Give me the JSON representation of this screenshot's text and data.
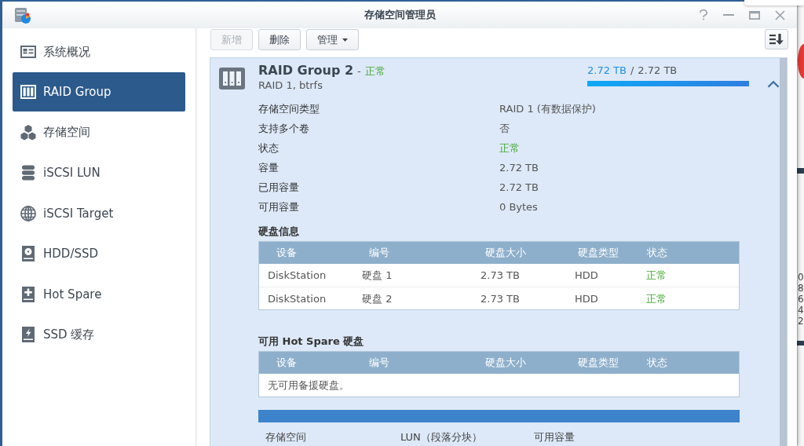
{
  "window": {
    "title": "存储空间管理员"
  },
  "sidebar": {
    "items": [
      {
        "label": "系统概况",
        "kind": "overview",
        "selected": false
      },
      {
        "label": "RAID Group",
        "kind": "raid",
        "selected": true
      },
      {
        "label": "存储空间",
        "kind": "storage",
        "selected": false
      },
      {
        "label": "iSCSI LUN",
        "kind": "lun",
        "selected": false
      },
      {
        "label": "iSCSI Target",
        "kind": "target",
        "selected": false
      },
      {
        "label": "HDD/SSD",
        "kind": "hdd",
        "selected": false
      },
      {
        "label": "Hot Spare",
        "kind": "hotspare",
        "selected": false
      },
      {
        "label": "SSD 缓存",
        "kind": "cache",
        "selected": false
      }
    ]
  },
  "toolbar": {
    "buttons": [
      {
        "label": "新增",
        "disabled": true,
        "dropdown": false
      },
      {
        "label": "删除",
        "disabled": false,
        "dropdown": false
      },
      {
        "label": "管理",
        "disabled": false,
        "dropdown": true
      }
    ]
  },
  "raid_group": {
    "name": "RAID Group 2",
    "separator": "-",
    "status": "正常",
    "healthy": true,
    "subtitle": "RAID 1, btrfs",
    "usage": {
      "used": "2.72 TB",
      "separator": "/",
      "total": "2.72 TB",
      "level": 1
    },
    "expanded": true,
    "details": [
      {
        "label": "存储空间类型",
        "value": "RAID 1 (有数据保护)",
        "kind": "text"
      },
      {
        "label": "支持多个卷",
        "value": "否",
        "kind": "text"
      },
      {
        "label": "状态",
        "value": "正常",
        "kind": "status"
      },
      {
        "label": "容量",
        "value": "2.72 TB",
        "kind": "text"
      },
      {
        "label": "已用容量",
        "value": "2.72 TB",
        "kind": "text"
      },
      {
        "label": "可用容量",
        "value": "0 Bytes",
        "kind": "text"
      }
    ],
    "disk_info": {
      "title": "硬盘信息",
      "columns": [
        "设备",
        "编号",
        "硬盘大小",
        "硬盘类型",
        "状态"
      ],
      "rows": [
        {
          "device": "DiskStation",
          "number": "硬盘 1",
          "size": "2.73 TB",
          "type": "HDD",
          "status": "正常",
          "healthy": true
        },
        {
          "device": "DiskStation",
          "number": "硬盘 2",
          "size": "2.73 TB",
          "type": "HDD",
          "status": "正常",
          "healthy": true
        }
      ]
    },
    "hot_spare": {
      "title": "可用 Hot Spare 硬盘",
      "columns": [
        "设备",
        "编号",
        "硬盘大小",
        "硬盘类型",
        "状态"
      ],
      "empty_text": "无可用备援硬盘。"
    },
    "volumes": {
      "columns": [
        "存储空间",
        "LUN（段落分块）",
        "可用容量"
      ]
    }
  },
  "background": {
    "labels": [
      "0",
      "8",
      "6",
      "4",
      "2"
    ]
  }
}
